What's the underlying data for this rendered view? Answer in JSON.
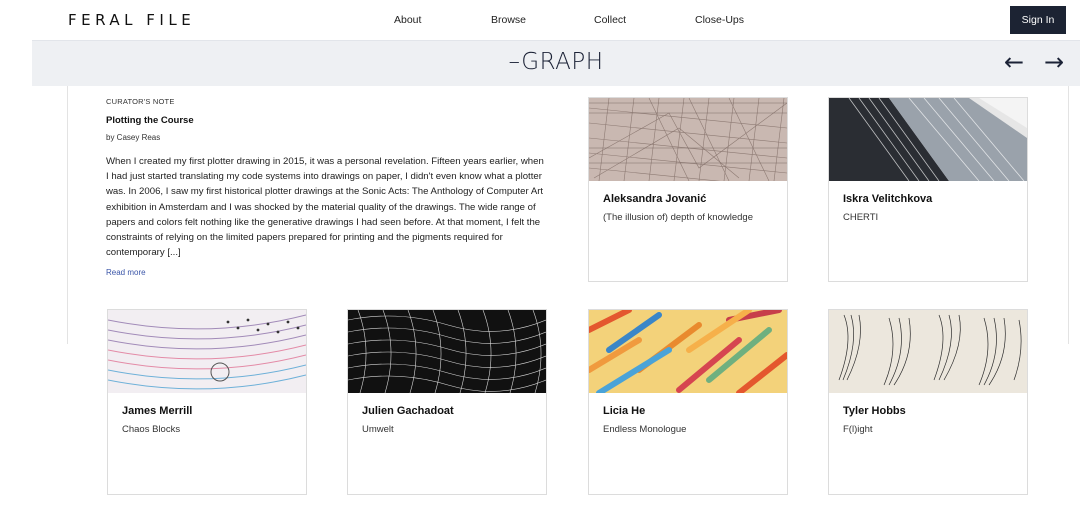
{
  "header": {
    "logo": "FERAL FILE",
    "nav": [
      "About",
      "Browse",
      "Collect",
      "Close-Ups"
    ],
    "signin_label": "Sign In"
  },
  "exhibition": {
    "title": "–GRAPH",
    "prev_icon": "arrow-left-icon",
    "next_icon": "arrow-right-icon"
  },
  "curator_note": {
    "label": "CURATOR'S NOTE",
    "title": "Plotting the Course",
    "author": "by Casey Reas",
    "body": "When I created my first plotter drawing in 2015, it was a personal revelation. Fifteen years earlier, when I had just started translating my code systems into drawings on paper, I didn't even know what a plotter was. In 2006, I saw my first historical plotter drawings at the Sonic Acts: The Anthology of Computer Art exhibition in Amsterdam and I was shocked by the material quality of the drawings. The wide range of papers and colors felt nothing like the generative drawings I had seen before. At that moment, I felt the constraints of relying on the limited papers prepared for printing and the pigments required for contemporary [...]",
    "read_more": "Read more"
  },
  "cards": [
    {
      "artist": "Aleksandra Jovanić",
      "work": "(The illusion of) depth of knowledge"
    },
    {
      "artist": "Iskra Velitchkova",
      "work": "CHERTI"
    },
    {
      "artist": "James Merrill",
      "work": "Chaos Blocks"
    },
    {
      "artist": "Julien Gachadoat",
      "work": "Umwelt"
    },
    {
      "artist": "Licia He",
      "work": "Endless Monologue"
    },
    {
      "artist": "Tyler Hobbs",
      "work": "F(l)ight"
    }
  ]
}
